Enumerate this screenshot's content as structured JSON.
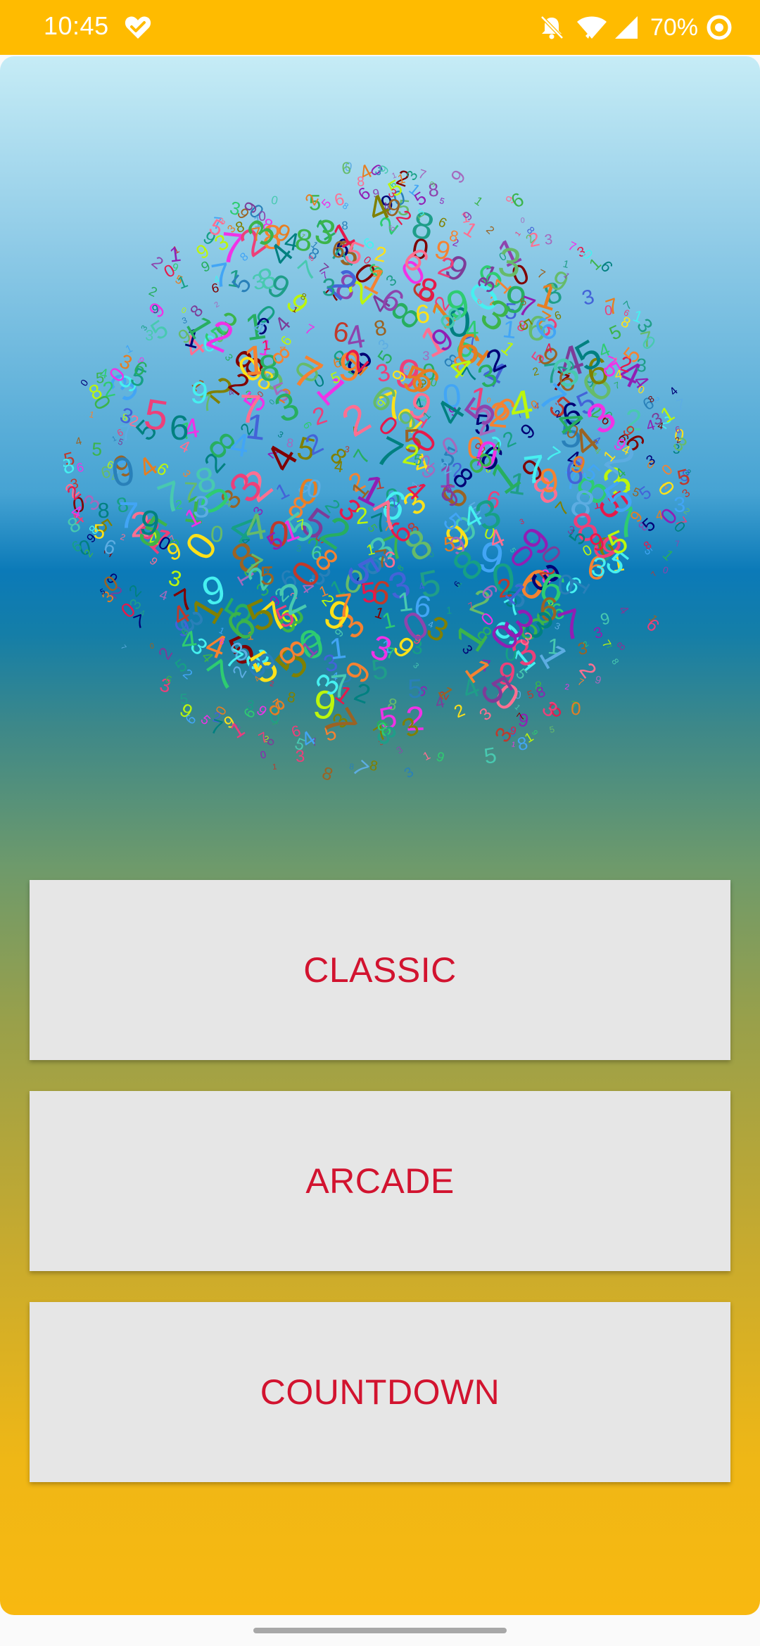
{
  "status_bar": {
    "time": "10:45",
    "battery": "70%",
    "background": "#ffbb00",
    "icons": [
      "health-heart-check-icon",
      "notifications-off-icon",
      "wifi-icon",
      "cellular-signal-icon",
      "data-saver-icon"
    ]
  },
  "artwork": {
    "description_icon": "random-digits-sphere-icon",
    "digits": [
      "0",
      "1",
      "2",
      "3",
      "4",
      "5",
      "6",
      "7",
      "8",
      "9"
    ],
    "palette": [
      "#e6194b",
      "#3cb44b",
      "#ffe119",
      "#4363d8",
      "#f58231",
      "#911eb4",
      "#46f0f0",
      "#f032e6",
      "#bcf60c",
      "#008080",
      "#9a6324",
      "#800000",
      "#808000",
      "#000075",
      "#1f9e89",
      "#ff6f91",
      "#5dade2",
      "#27ae60",
      "#8e44ad",
      "#e67e22",
      "#16a085",
      "#c0392b",
      "#2980b9",
      "#7d3c98",
      "#2ecc71",
      "#a569bd",
      "#48c9b0",
      "#ec407a",
      "#66bb6a",
      "#42a5f5"
    ]
  },
  "menu": {
    "classic_label": "CLASSIC",
    "arcade_label": "ARCADE",
    "countdown_label": "COUNTDOWN",
    "button_color": "#e6e6e6",
    "label_color": "#d2132f"
  }
}
